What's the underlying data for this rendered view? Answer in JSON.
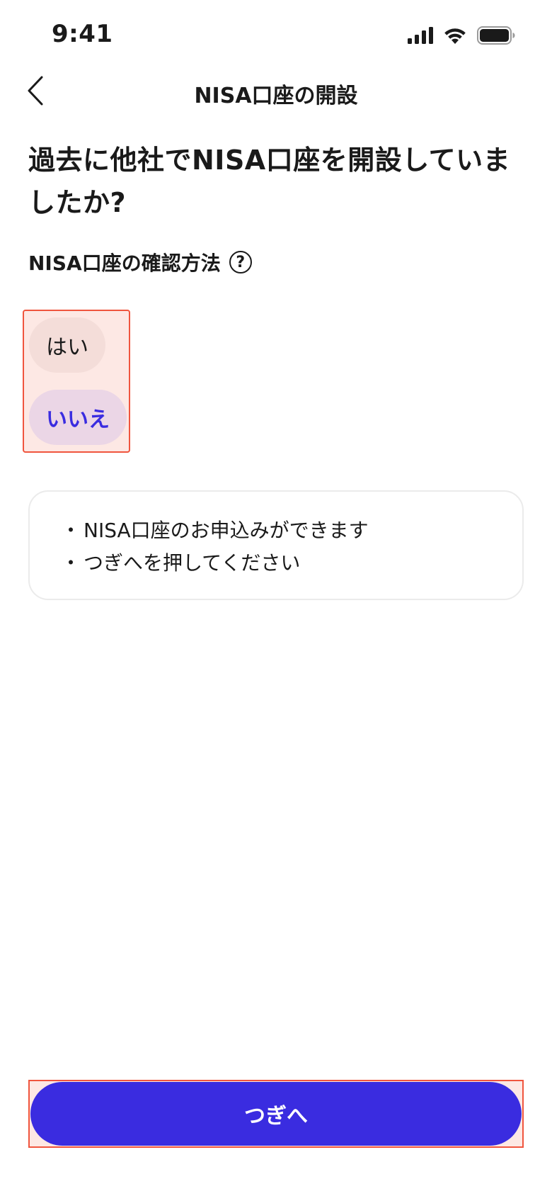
{
  "status_bar": {
    "time": "9:41",
    "icons": [
      "cellular-signal-icon",
      "wifi-icon",
      "battery-icon"
    ]
  },
  "header": {
    "back_icon": "chevron-left-icon",
    "title": "NISA口座の開設"
  },
  "question": {
    "title_line1": "過去に他社でNISA口座を開設していま",
    "title_line2": "したか?"
  },
  "subheading": {
    "label": "NISA口座の確認方法",
    "help_icon": "question-circle-icon",
    "help_glyph": "?"
  },
  "options": {
    "yes_label": "はい",
    "no_label": "いいえ",
    "selected": "いいえ"
  },
  "info": {
    "bullet": "・",
    "lines": [
      "NISA口座のお申込みができます",
      "つぎへを押してください"
    ]
  },
  "footer": {
    "next_label": "つぎへ"
  },
  "colors": {
    "accent": "#3a2ce0",
    "highlight_border": "#f0553e",
    "highlight_fill": "#fde8e4",
    "selected_pill": "#ebd6e6",
    "unselected_pill": "#f4ddd9"
  }
}
